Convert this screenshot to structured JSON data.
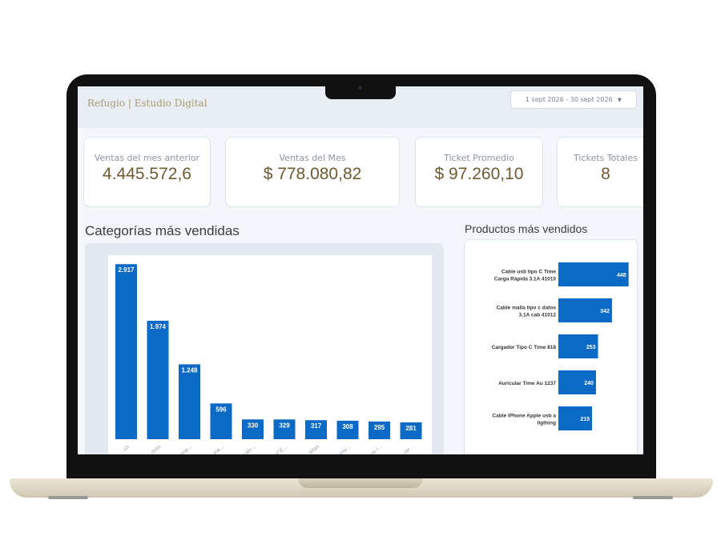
{
  "brand": "Refugio | Estudio Digital",
  "date_range": {
    "label": "1 sept 2026 - 30 sept 2026",
    "icon": "caret-down-icon"
  },
  "kpis": [
    {
      "label": "Ventas del mes anterior",
      "value": "4.445.572,6"
    },
    {
      "label": "Ventas del Mes",
      "value": "$ 778.080,82"
    },
    {
      "label": "Ticket Promedio",
      "value": "$ 97.260,10"
    },
    {
      "label": "Tickets Totales",
      "value": "8"
    }
  ],
  "categories_title": "Categorías más vendidas",
  "products_title": "Productos más vendidos",
  "colors": {
    "bar": "#0b6ac6",
    "kpi_value": "#6e5a33"
  },
  "chart_data": [
    {
      "type": "bar",
      "orientation": "vertical",
      "values": [
        2917,
        1974,
        1248,
        596,
        330,
        329,
        317,
        308,
        295,
        281
      ],
      "value_labels": [
        "2.917",
        "1.974",
        "1.248",
        "596",
        "330",
        "329",
        "317",
        "308",
        "295",
        "281"
      ],
      "tick_labels": [
        "...us",
        "...ores",
        "...ene...",
        "...ine...",
        "...ram...",
        "...s/ E...",
        "...ielas",
        "...ensi...",
        "...os /...",
        "...rer..."
      ],
      "ylim": [
        0,
        3000
      ],
      "grid": false
    },
    {
      "type": "bar",
      "orientation": "horizontal",
      "categories": [
        "Cable usb tipo C Time Carga Rápida 3.1A 41010",
        "Cable malla tipo c datos 3.1A cab 41012",
        "Cargador Tipo C Time 818",
        "Auricular Time Au 1237",
        "Cable iPhone Apple usb a ligthing"
      ],
      "values": [
        448,
        342,
        253,
        240,
        215
      ],
      "xlim": [
        0,
        460
      ],
      "grid": false
    }
  ]
}
